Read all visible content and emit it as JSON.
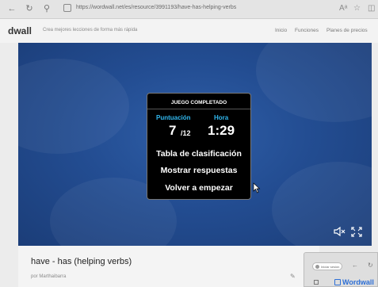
{
  "browser": {
    "url": "https://wordwall.net/es/resource/3991193/have-has-helping-verbs"
  },
  "site": {
    "logo": "dwall",
    "tagline": "Crea mejores lecciones de forma más rápida",
    "nav": [
      "Inicio",
      "Funciones",
      "Planes de precios"
    ]
  },
  "game": {
    "panel_title": "JUEGO COMPLETADO",
    "score_label": "Puntuación",
    "time_label": "Hora",
    "score": "7",
    "score_total": "/12",
    "time": "1:29",
    "menu": [
      "Tabla de clasificación",
      "Mostrar respuestas",
      "Volver a empezar"
    ]
  },
  "activity": {
    "title": "have - has (helping verbs)",
    "author": "por  Marthaibarra"
  },
  "thumbnail": {
    "pill_text": "Iniciar sesión",
    "logo": "Wordwall"
  },
  "colors": {
    "game_background": "#234d92",
    "label_blue": "#31b8ef",
    "panel": "#000000"
  }
}
